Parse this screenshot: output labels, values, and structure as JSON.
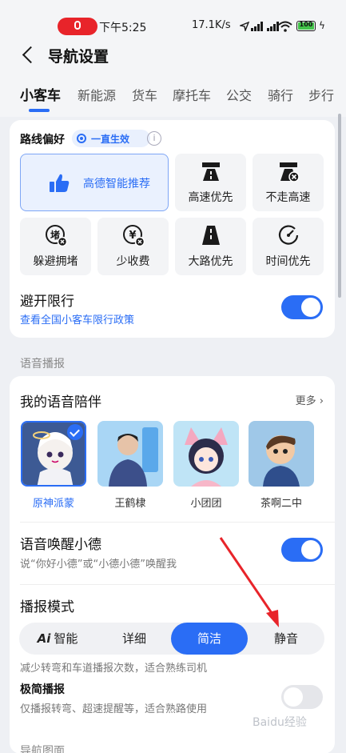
{
  "status_bar": {
    "time": "下午5:25",
    "network_speed": "17.1K/s",
    "battery": "100",
    "icons": [
      "mic-icon",
      "location-icon",
      "signal-icon",
      "wifi-icon",
      "battery-icon",
      "charging-icon"
    ]
  },
  "header": {
    "title": "导航设置"
  },
  "tabs": [
    "小客车",
    "新能源",
    "货车",
    "摩托车",
    "公交",
    "骑行",
    "步行"
  ],
  "route": {
    "preference_label": "路线偏好",
    "preference_pill": "一直生效",
    "options": [
      {
        "label": "高德智能推荐",
        "icon": "thumbs-up-icon",
        "selected": true
      },
      {
        "label": "高速优先",
        "icon": "highway-icon"
      },
      {
        "label": "不走高速",
        "icon": "no-highway-icon"
      },
      {
        "label": "躲避拥堵",
        "icon": "avoid-congestion-icon"
      },
      {
        "label": "少收费",
        "icon": "less-toll-icon"
      },
      {
        "label": "大路优先",
        "icon": "main-road-icon"
      },
      {
        "label": "时间优先",
        "icon": "clock-icon"
      }
    ],
    "restriction_title": "避开限行",
    "restriction_link": "查看全国小客车限行政策",
    "restriction_on": true
  },
  "voice_section_title": "语音播报",
  "voice": {
    "companion_title": "我的语音陪伴",
    "more_label": "更多",
    "avatars": [
      {
        "name": "原神派蒙",
        "selected": true
      },
      {
        "name": "王鹤棣",
        "selected": false
      },
      {
        "name": "小团团",
        "selected": false
      },
      {
        "name": "茶啊二中",
        "selected": false
      }
    ],
    "wake_title": "语音唤醒小德",
    "wake_sub": "说“你好小德”或“小德小德”唤醒我",
    "wake_on": true,
    "mode_title": "播报模式",
    "modes": [
      "Ai",
      "智能",
      "详细",
      "简洁",
      "静音"
    ],
    "active_mode": "简洁",
    "mode_desc": "减少转弯和车道播报次数，适合熟练司机",
    "minimal_title": "极简播报",
    "minimal_desc": "仅播报转弯、超速提醒等，适合熟路使用",
    "minimal_on": false
  },
  "next_section_title": "导航图面",
  "colors": {
    "accent": "#2a6df5",
    "annotation_arrow": "#e8242a"
  },
  "watermark": "Baidu经验"
}
